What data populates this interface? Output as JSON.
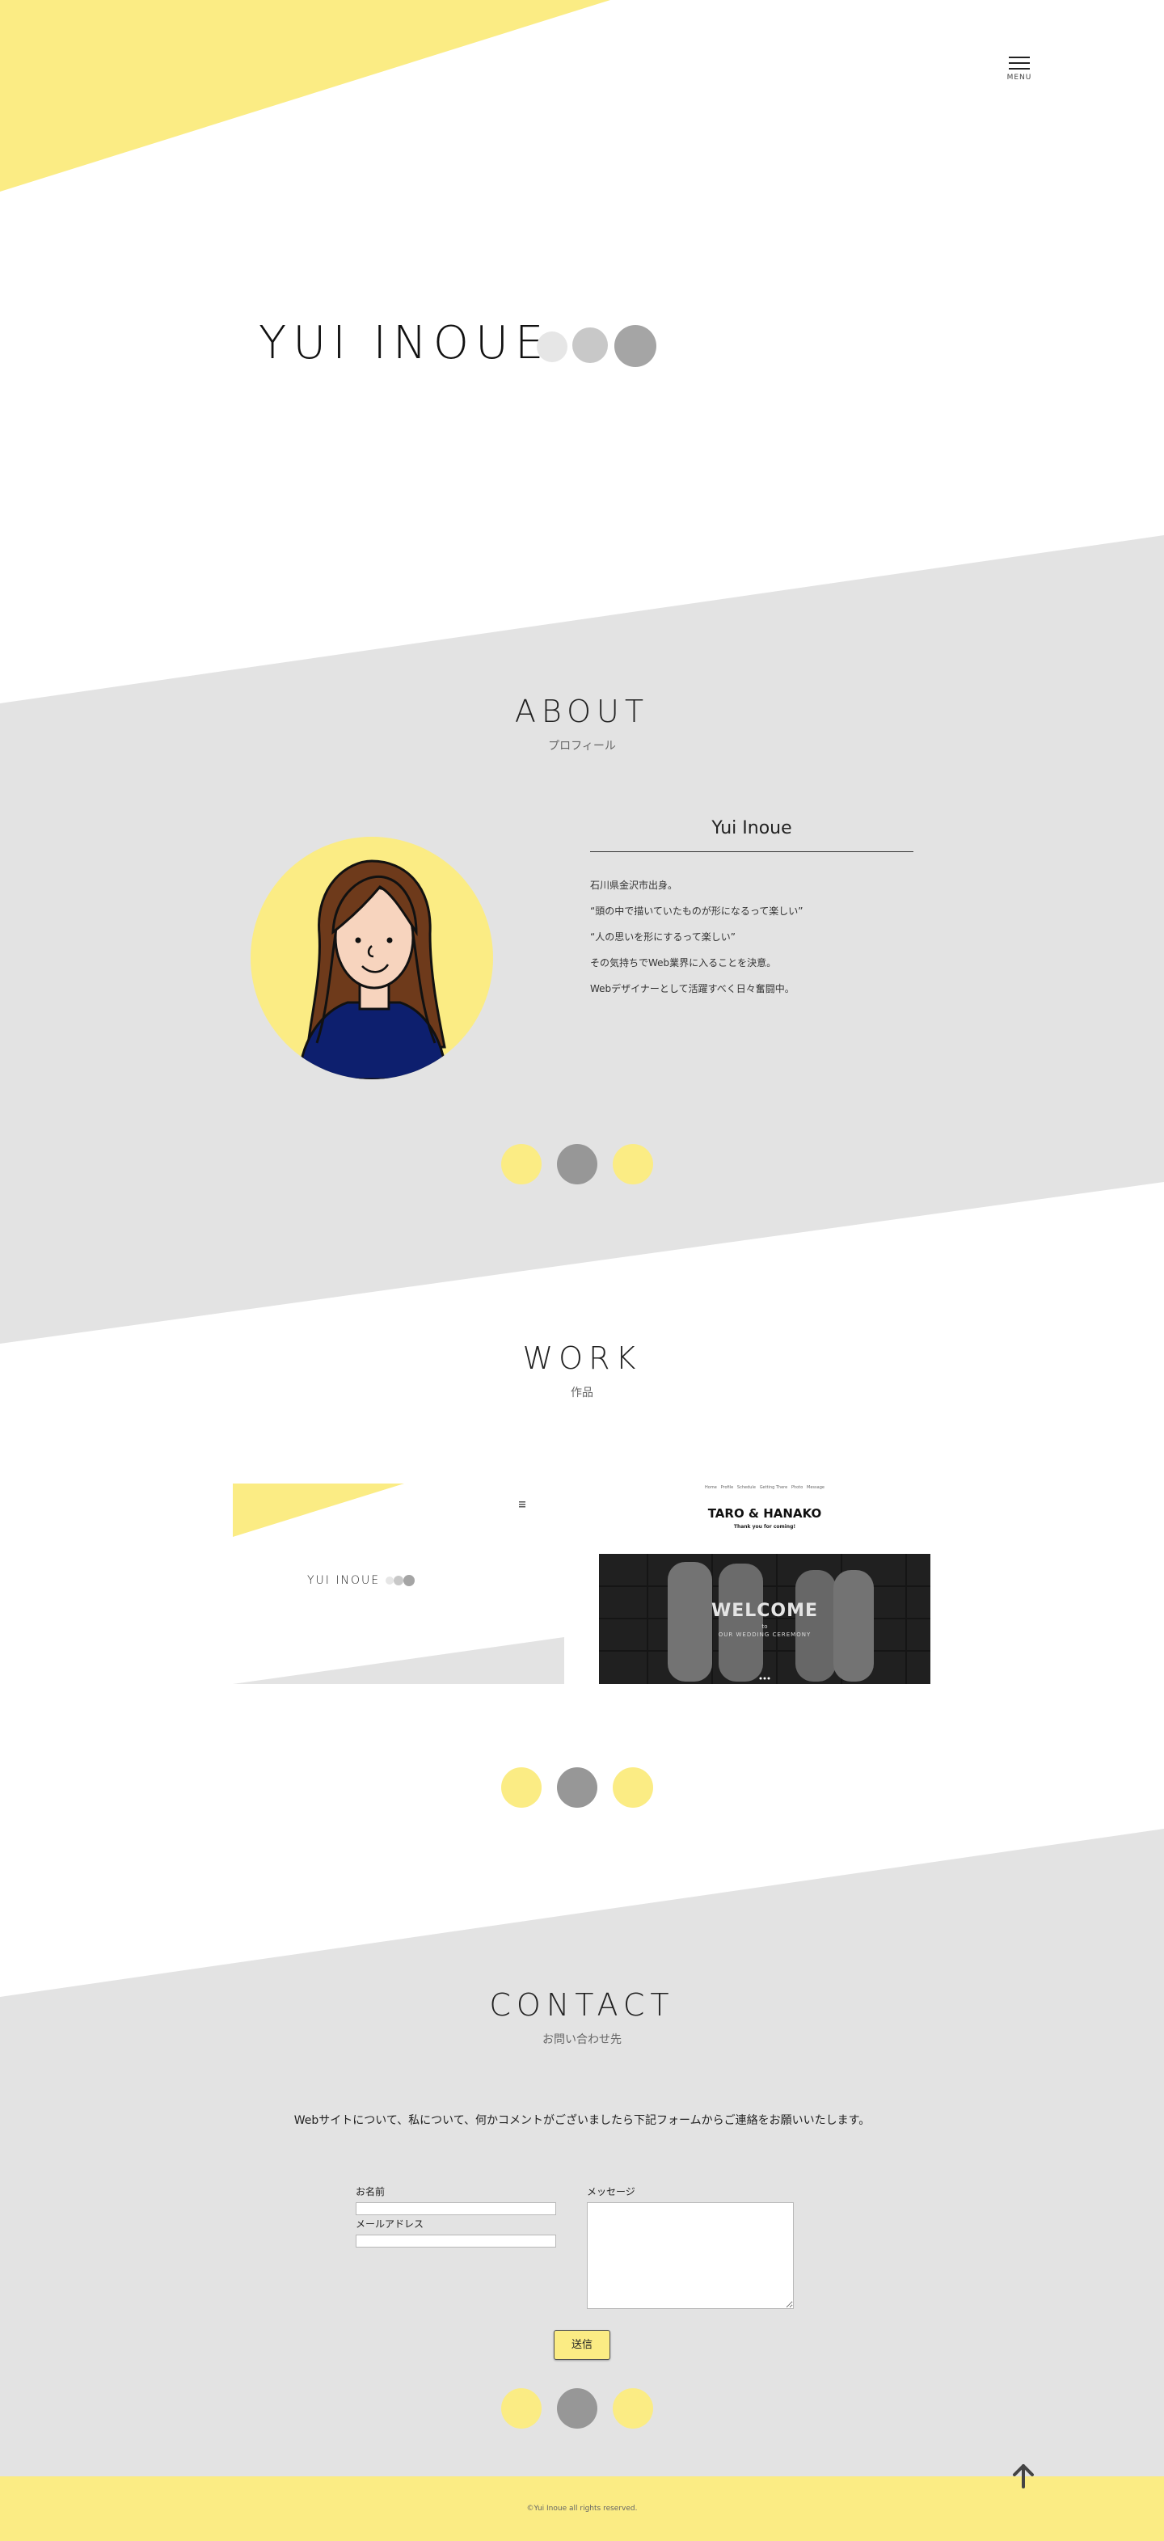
{
  "header": {
    "menu_label": "MENU"
  },
  "hero": {
    "title": "YUI INOUE"
  },
  "about": {
    "title": "ABOUT",
    "subtitle": "プロフィール",
    "name": "Yui Inoue",
    "lines": [
      "石川県金沢市出身。",
      "“頭の中で描いていたものが形になるって楽しい”",
      "“人の思いを形にするって楽しい”",
      "その気持ちでWeb業界に入ることを決意。",
      "Webデザイナーとして活躍すべく日々奮闘中。"
    ]
  },
  "work": {
    "title": "WORK",
    "subtitle": "作品",
    "items": [
      {
        "thumb_title": "YUI INOUE"
      },
      {
        "nav": [
          "Home",
          "Profile",
          "Schedule",
          "Getting There",
          "Photo",
          "Message"
        ],
        "site_title": "TARO & HANAKO",
        "site_tagline": "Thank you for coming!",
        "hero_heading": "WELCOME",
        "hero_sub1": "to",
        "hero_sub2": "OUR WEDDING CEREMONY"
      }
    ]
  },
  "contact": {
    "title": "CONTACT",
    "subtitle": "お問い合わせ先",
    "message": "Webサイトについて、私について、何かコメントがございましたら下記フォームからご連絡をお願いいたします。",
    "name_label": "お名前",
    "email_label": "メールアドレス",
    "message_label": "メッセージ",
    "name_value": "",
    "email_value": "",
    "message_value": "",
    "submit_label": "送信"
  },
  "footer": {
    "copyright": "©Yui Inoue all rights reserved."
  },
  "colors": {
    "accent_yellow": "#fbec84",
    "band_gray": "#e3e3e3",
    "dot_gray": "#979797",
    "hero_dot_light": "#e6e6e6",
    "hero_dot_mid": "#c8c8c8",
    "hero_dot_dark": "#a5a5a5"
  },
  "icons": {
    "menu": "hamburger-icon",
    "to_top": "arrow-up-icon"
  }
}
